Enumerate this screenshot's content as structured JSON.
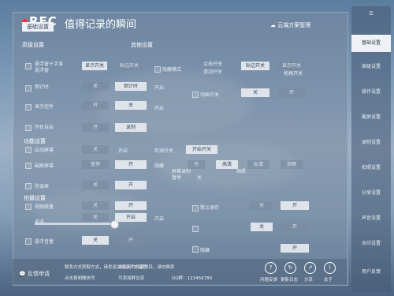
{
  "header": {
    "rec": "REC",
    "title": "值得记录的瞬间",
    "cloud": "云端方案管理",
    "menu_label": "☰"
  },
  "tabs": [
    "基础设置",
    "高级设置",
    "其他设置"
  ],
  "sidebar": {
    "items": [
      "基础设置",
      "高级设置",
      "操作设置",
      "截屏设置",
      "录制设置",
      "拍照设置",
      "分享设置",
      "声音设置",
      "水印设置",
      "用户反馈"
    ]
  },
  "rows": {
    "r1": [
      "悬浮窗十字准",
      "悬浮窗",
      "显示开关",
      "贴边开关",
      "隐藏模式",
      "点击开关",
      "贴边开关",
      "显示开关",
      "滑动开关",
      "拖拽开关",
      "开启",
      "开"
    ],
    "r2": [
      "倒计时",
      "关",
      "倒计时",
      "开启",
      "动画开关",
      "关",
      "开"
    ],
    "r3": [
      "显示控件",
      "开",
      "关",
      "开启",
      "提示",
      "开"
    ],
    "r4": [
      "开机自启",
      "开",
      "录制",
      "暂停",
      "开"
    ],
    "feature_head": "功能设置",
    "f1": [
      "启动屏幕",
      "关",
      "开启",
      "检测开关",
      "开始开关"
    ],
    "f2": [
      "副屏屏幕",
      "暂停",
      "开",
      "隐藏",
      "开",
      "屏幕录制",
      "暂停",
      "关",
      "画质",
      "高清",
      "标清",
      "流畅"
    ],
    "f3": [
      "防录屏",
      "关",
      "开"
    ],
    "adv_head": "拍摄设置",
    "a1": [
      "视频质量",
      "关",
      "开",
      "默认保存",
      "关",
      "开"
    ],
    "a2": [
      "声道",
      "关",
      "开启",
      "开启",
      "关",
      "开"
    ],
    "a3": [
      "悬浮音量",
      "关",
      "开",
      "隐藏",
      "开"
    ]
  },
  "bottom": {
    "feedback": "反馈申请",
    "l1": "联系方式获取方式，请发送关键词下方留言",
    "l2": "点击复制微信号",
    "l3": "本应用为开源项目，请勿倒卖",
    "l4": "可添加群交流",
    "l5": "QQ群：123456789",
    "icons": [
      "问题反馈",
      "更新日志",
      "分享",
      "关于"
    ]
  }
}
